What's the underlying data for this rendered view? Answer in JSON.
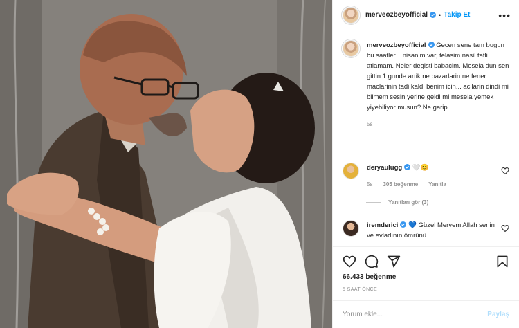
{
  "post": {
    "username": "merveozbeyofficial",
    "follow_label": "Takip Et",
    "separator": "•",
    "more_label": "•••"
  },
  "caption": {
    "username": "merveozbeyofficial",
    "text": "Gecen sene tam bugun bu saatler... nisanim var, telasim nasil tatli atlamam. Neler degisti babacim. Mesela dun sen gittin 1 gunde artik ne pazarlarin ne fener maclarinin tadi kaldi benim icin... acilarin dindi mi bilmem sesin yerine geldi mi mesela yemek yiyebiliyor musun? Ne garip...",
    "age": "5s"
  },
  "comments": [
    {
      "username": "deryaulugg",
      "text": "🤍😊",
      "age": "5s",
      "likes": "305 beğenme",
      "reply_label": "Yanıtla",
      "view_replies": "Yanıtları gör (3)"
    },
    {
      "username": "iremderici",
      "text": "💙 Güzel Mervem Allah senin ve evladının ömrünü"
    }
  ],
  "footer": {
    "likes": "66.433 beğenme",
    "time": "5 SAAT ÖNCE",
    "comment_placeholder": "Yorum ekle...",
    "post_label": "Paylaş"
  },
  "icons": [
    "verified-badge-icon",
    "heart-icon",
    "comment-icon",
    "share-icon",
    "bookmark-icon",
    "more-icon"
  ],
  "colors": {
    "link": "#0095f6",
    "verified": "#3897f0",
    "muted": "#8e8e8e",
    "text": "#262626",
    "post_disabled": "#b2dffc"
  }
}
